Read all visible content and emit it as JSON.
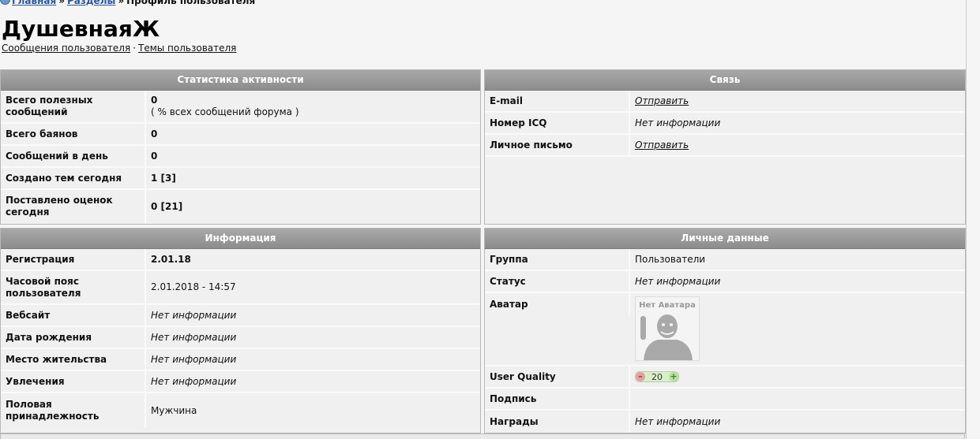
{
  "breadcrumb": {
    "home": "Главная",
    "sections": "Разделы",
    "current": "Профиль пользователя",
    "sep": "»"
  },
  "title": "ДушевнаяЖ",
  "user_links": {
    "posts": "Сообщения пользователя",
    "dot": "·",
    "topics": "Темы пользователя"
  },
  "activity": {
    "header": "Статистика активности",
    "rows": [
      {
        "label": "Всего полезных сообщений",
        "value": "0",
        "note": "( % всех сообщений форума )"
      },
      {
        "label": "Всего баянов",
        "value": "0"
      },
      {
        "label": "Сообщений в день",
        "value": "0"
      },
      {
        "label": "Создано тем сегодня",
        "value": "1 [3]"
      },
      {
        "label": "Поставлено оценок сегодня",
        "value": "0 [21]"
      }
    ]
  },
  "contact": {
    "header": "Связь",
    "rows": [
      {
        "label": "E-mail",
        "value": "Отправить"
      },
      {
        "label": "Номер ICQ",
        "value": "Нет информации"
      },
      {
        "label": "Личное письмо",
        "value": "Отправить"
      }
    ]
  },
  "info": {
    "header": "Информация",
    "rows": [
      {
        "label": "Регистрация",
        "value": "2.01.18"
      },
      {
        "label": "Часовой пояс пользователя",
        "value": "2.01.2018 - 14:57"
      },
      {
        "label": "Вебсайт",
        "value": "Нет информации"
      },
      {
        "label": "Дата рождения",
        "value": "Нет информации"
      },
      {
        "label": "Место жительства",
        "value": "Нет информации"
      },
      {
        "label": "Увлечения",
        "value": "Нет информации"
      },
      {
        "label": "Половая принадлежность",
        "value": "Мужчина"
      }
    ]
  },
  "personal": {
    "header": "Личные данные",
    "rows": [
      {
        "label": "Группа",
        "value": "Пользователи"
      },
      {
        "label": "Статус",
        "value": "Нет информации"
      },
      {
        "label": "Аватар",
        "value": "Нет Аватара"
      },
      {
        "label": "User Quality",
        "value": "20",
        "minus": "–",
        "plus": "+"
      },
      {
        "label": "Подпись",
        "value": ""
      },
      {
        "label": "Награды",
        "value": "Нет информации"
      }
    ]
  }
}
